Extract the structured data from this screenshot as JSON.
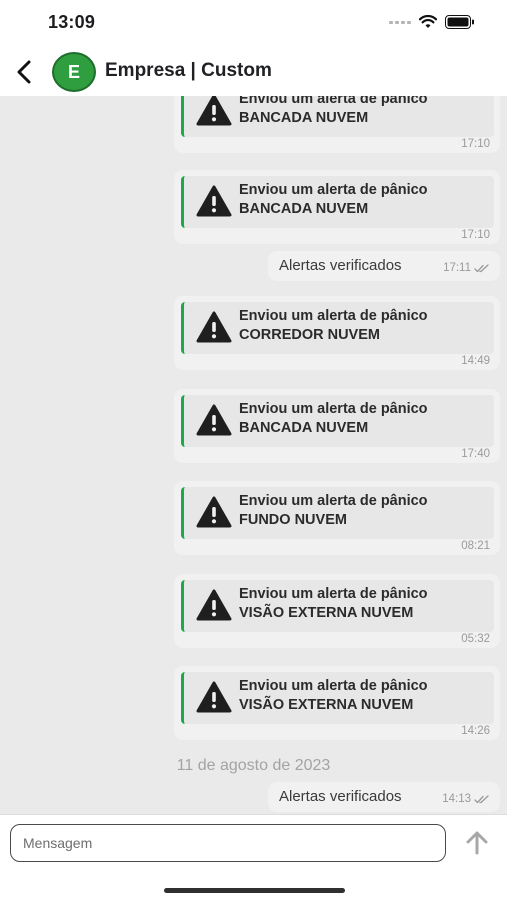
{
  "status_bar": {
    "time": "13:09"
  },
  "header": {
    "avatar_letter": "E",
    "title": "Empresa | Custom"
  },
  "messages": [
    {
      "kind": "alert",
      "line1": "Enviou um alerta de pânico",
      "line2": "BANCADA NUVEM",
      "time": "17:10"
    },
    {
      "kind": "alert",
      "line1": "Enviou um alerta de pânico",
      "line2": "BANCADA NUVEM",
      "time": "17:10"
    },
    {
      "kind": "text",
      "text": "Alertas verificados",
      "time": "17:11",
      "status_icon": "double-check-icon"
    },
    {
      "kind": "alert",
      "line1": "Enviou um alerta de pânico",
      "line2": "CORREDOR NUVEM",
      "time": "14:49"
    },
    {
      "kind": "alert",
      "line1": "Enviou um alerta de pânico",
      "line2": "BANCADA NUVEM",
      "time": "17:40"
    },
    {
      "kind": "alert",
      "line1": "Enviou um alerta de pânico",
      "line2": "FUNDO NUVEM",
      "time": "08:21"
    },
    {
      "kind": "alert",
      "line1": "Enviou um alerta de pânico",
      "line2": "VISÃO EXTERNA NUVEM",
      "time": "05:32"
    },
    {
      "kind": "alert",
      "line1": "Enviou um alerta de pânico",
      "line2": "VISÃO EXTERNA NUVEM",
      "time": "14:26"
    },
    {
      "kind": "date",
      "text": "11 de agosto de 2023"
    },
    {
      "kind": "text",
      "text": "Alertas verificados",
      "time": "14:13",
      "status_icon": "double-check-icon"
    }
  ],
  "composer": {
    "placeholder": "Mensagem",
    "value": ""
  },
  "colors": {
    "accent_green": "#1fa84a",
    "avatar_green": "#2e9e3f",
    "chat_background": "#eaeaea"
  },
  "icons": [
    "back-chevron-icon",
    "warning-icon",
    "double-check-icon",
    "send-arrow-icon",
    "wifi-icon",
    "battery-icon"
  ]
}
